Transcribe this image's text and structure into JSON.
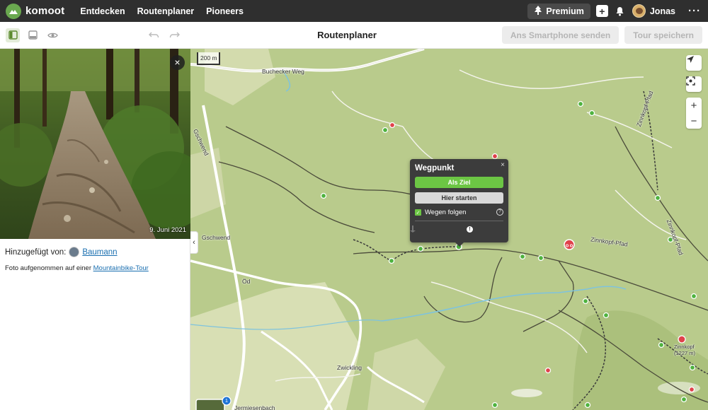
{
  "nav": {
    "brand": "komoot",
    "links": [
      "Entdecken",
      "Routenplaner",
      "Pioneers"
    ],
    "premium_label": "Premium",
    "user_name": "Jonas",
    "more": "···"
  },
  "toolbar": {
    "title": "Routenplaner",
    "send_label": "Ans Smartphone senden",
    "save_label": "Tour speichern"
  },
  "panel": {
    "photo_date": "9. Juni 2021",
    "close": "×",
    "added_by_label": "Hinzugefügt von:",
    "added_by_user": "Baumann",
    "caption_prefix": "Foto aufgenommen auf einer",
    "caption_link": "Mountainbike-Tour",
    "collapse": "‹"
  },
  "map": {
    "scale_label": "200 m",
    "labels": {
      "buchecker_weg": "Buchecker Weg",
      "gschwend_road": "Gschwend",
      "gschwend_place": "Gschwend",
      "od": "Öd",
      "zwickling": "Zwickling",
      "jermiesenbach": "Jermiesenbach",
      "zinnkopf_pfad": "Zinnkopf-Pfad",
      "zinnkopf_pfad_right": "Zinnkopf-Pfad",
      "zinnkopf_pfad_top": "Zinnkopf-Pfad",
      "zinnkopf": "Zinnkopf",
      "zinnkopf_elev": "(1227 m)"
    },
    "cluster_count": "1",
    "zoom_in": "+",
    "zoom_out": "−",
    "colors": {
      "green_marker": "#4fb33f",
      "red_marker": "#e0424b",
      "water": "#7ec3de"
    }
  },
  "popup": {
    "title": "Wegpunkt",
    "close": "×",
    "set_destination": "Als Ziel",
    "start_here": "Hier starten",
    "follow_paths": "Wegen folgen",
    "follow_checked": true,
    "help": "?",
    "warning": "!"
  }
}
